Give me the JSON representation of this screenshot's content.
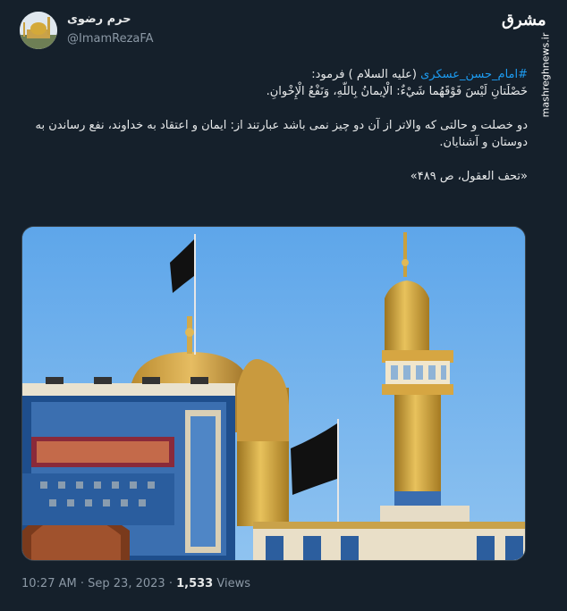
{
  "tweet": {
    "display_name": "حرم رضوی",
    "handle": "@ImamRezaFA",
    "hashtag": "#امام_حسن_عسکری",
    "line1_rest": " (علیه السلام ) فرمود:",
    "line2": "خَصْلَتانِ لَيْسَ فَوْقَهُما شَيْءٌ: الْإيمانُ بِاللّهِ، وَنَفْعُ الْإِخْوانِ.",
    "para2": "دو خصلت و حالتی که والاتر از آن دو چیز نمی باشد عبارتند از: ایمان و اعتقاد به خداوند، نفع رساندن به دوستان و آشنایان.",
    "source": "«تحف العقول، ص ۴۸۹»"
  },
  "meta": {
    "time": "10:27 AM",
    "separator": "·",
    "date": "Sep 23, 2023",
    "views_count": "1,533",
    "views_label": "Views"
  },
  "watermark": {
    "logo_text": "مشرق",
    "site": "mashreghnews.ir"
  },
  "icons": {
    "avatar": "shrine-avatar-image",
    "photo": "shrine-dome-minaret-photo"
  },
  "colors": {
    "background": "#15202b",
    "hashtag": "#1d9bf0",
    "muted": "#8b98a5",
    "text": "#e7e9ea"
  }
}
